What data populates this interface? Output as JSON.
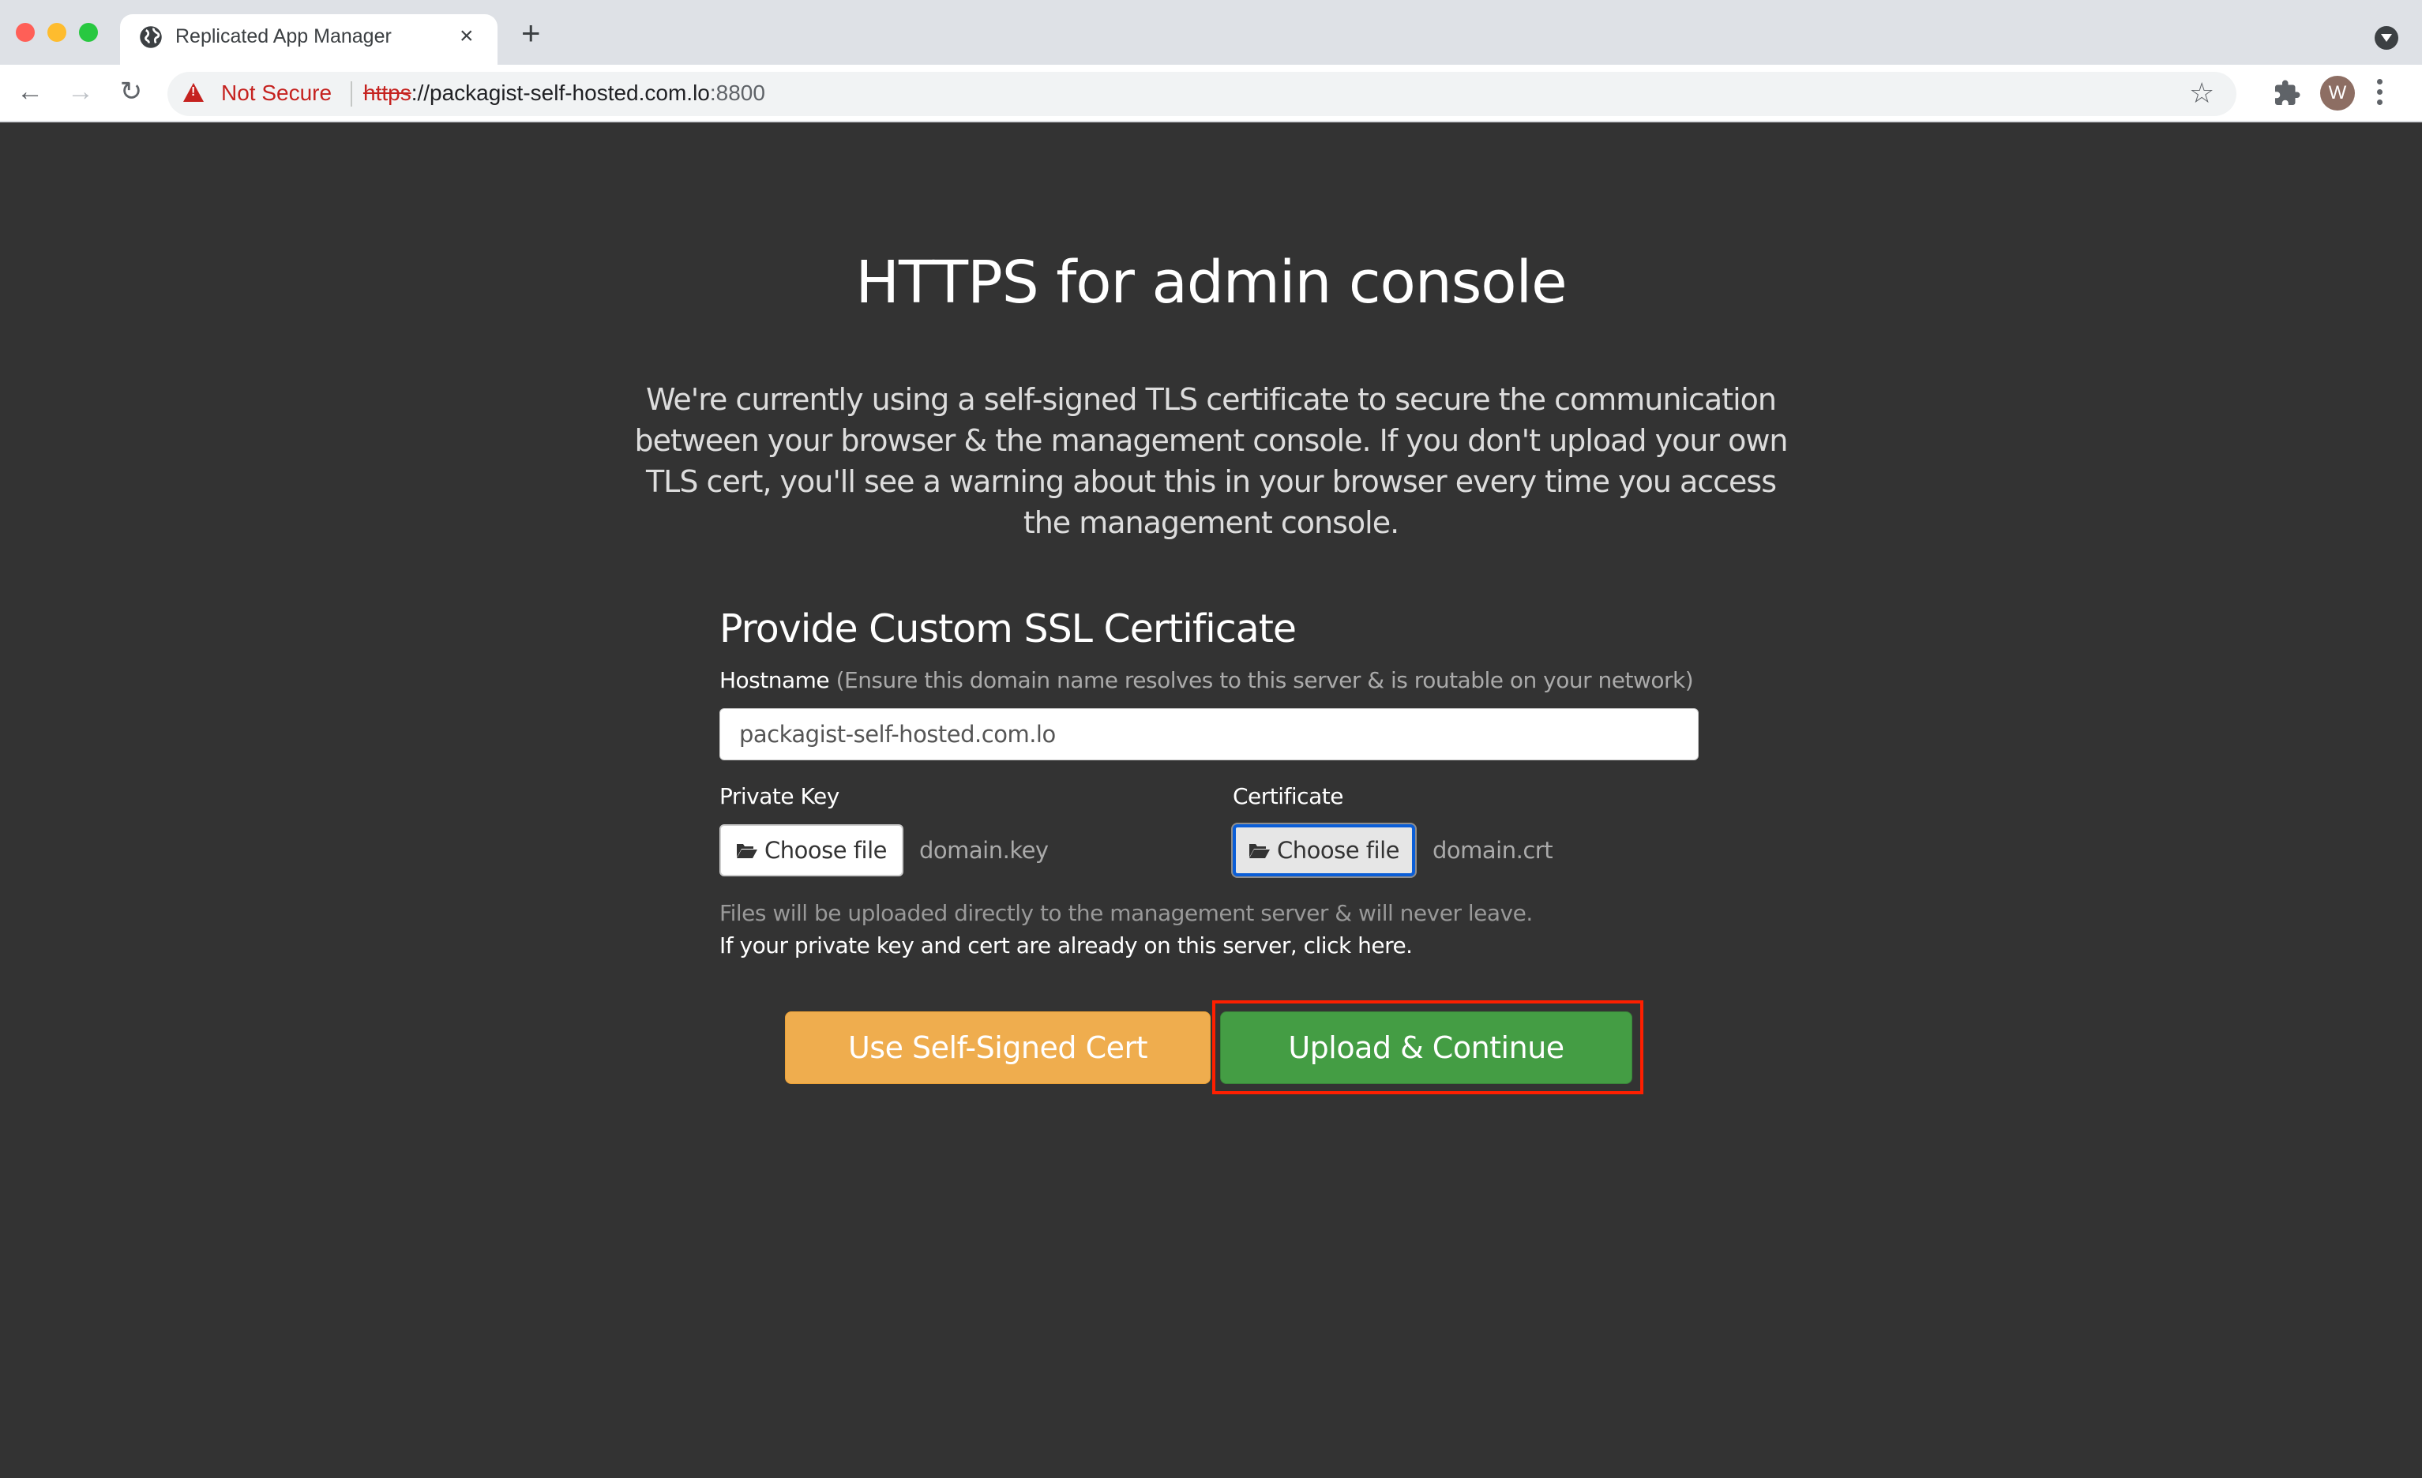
{
  "browser": {
    "tab_title": "Replicated App Manager",
    "tab_close": "×",
    "new_tab": "+",
    "security_label": "Not Secure",
    "url_scheme": "https",
    "url_rest": "://packagist-self-hosted.com.lo",
    "url_port": ":8800",
    "profile_initial": "W",
    "back_glyph": "←",
    "forward_glyph": "→",
    "reload_glyph": "↻",
    "star_glyph": "☆",
    "traffic_lights": {
      "close": "#ff5f57",
      "minimize": "#febc2e",
      "maximize": "#28c840"
    }
  },
  "page": {
    "title": "HTTPS for admin console",
    "intro": "We're currently using a self-signed TLS certificate to secure the communication between your browser & the management console. If you don't upload your own TLS cert, you'll see a warning about this in your browser every time you access the management console.",
    "form": {
      "title": "Provide Custom SSL Certificate",
      "hostname_label": "Hostname",
      "hostname_hint": " (Ensure this domain name resolves to this server & is routable on your network)",
      "hostname_value": "packagist-self-hosted.com.lo",
      "private_key_label": "Private Key",
      "private_key_button": "Choose file",
      "private_key_file": "domain.key",
      "certificate_label": "Certificate",
      "certificate_button": "Choose file",
      "certificate_file": "domain.crt",
      "files_note": "Files will be uploaded directly to the management server & will never leave.",
      "existing_link": "If your private key and cert are already on this server, click here."
    },
    "actions": {
      "self_signed": "Use Self-Signed Cert",
      "upload": "Upload & Continue"
    }
  },
  "colors": {
    "page_bg": "#333333",
    "self_signed_btn": "#efad4e",
    "upload_btn": "#449d44",
    "highlight": "#ff1f00",
    "insecure": "#c5221f"
  }
}
